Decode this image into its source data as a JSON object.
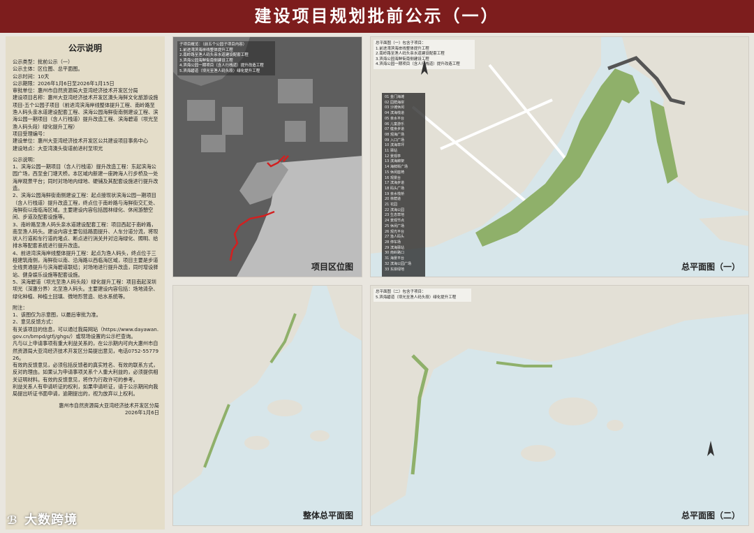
{
  "header": {
    "title": "建设项目规划批前公示（一）"
  },
  "sidebar": {
    "title": "公示说明",
    "lines": [
      "公示类型：批前公示（一）",
      "公示主体：区位图、总平面图。",
      "公示时间：10天",
      "公示期限：2026年1月6日至2026年1月15日",
      "审批单位：惠州市自然资源局大亚湾经济技术开发区分局",
      "建设项目名称：惠州大亚湾经济技术开发区澳头海鲜文化旅游设施项目-五个公园子项目（前进湾滨海岸线整体提升工程、南岭路至渔人码头亲水道建设配套工程、滨海公园海鲜街南侧建设工程、滨海公园一期项目（含人行栈道）提升改造工程、滨海碧道（坝光至渔人码头段）绿化提升工程）",
      "项目受理编号：",
      "建设单位：惠州大亚湾经济技术开发区公共建设项目事务中心",
      "建设地点：大亚湾澳头街道前进村至坝光",
      "",
      "公示说明：",
      "1、滨海公园一期项目（含人行栈道）提升改造工程：东起滨海公园广场，西至金门塘天桥。本区域内新建一座跨海人行步桥及一处海岸观景平台；同时对场地内绿地、硬铺及其配套设施进行提升改造。",
      "2、滨海公园海鲜街南侧建设工程：起点接现状滨海公园一期项目（含人行栈道）提升改造工程，终点位于南岭路与海鲜街交汇处、海鲜街以南临海区域。主要建设内容包括园林绿化、休闲游憩空间、步道及配套设施等。",
      "3、南岭路至渔人码头亲水道建设配套工程：项目西起于南岭路，南至渔人码头。建设内容主要包括路面提升、人车分道分流，将现状人行道和车行道的堵点、断点进行消关并对沿海绿化、照明、给排水等配套系统进行提升改造。",
      "4、前进湾滨海岸线整体提升工程：起点为渔人码头，终点位于三桠建筑南侧，海鲜街以南、沿海路以西临海区域，项目主要是步道全线贯通提升与滨海碧道联结；对场地进行提升改造，同时增设驿站、健身娱乐设施等配套设施。",
      "5、滨海碧道（坝光至渔人码头段）绿化提升工程：项目南起深圳坝光（深惠分界）北至渔人码头。主要建设内容包括：场地清杂、绿化种植、种植土回填、微地形营造、给水系统等。",
      "",
      "附注：",
      "1、该图仅为示意图，以最后审批为准。",
      "2、意见反馈方式：",
      "有关该项目的信息，可以通过我局网站（https://www.dayawan.gov.cn/bmpd/gtfj/ghgs/）或现场设置的公示栏查询。",
      "凡与以上申请事项有重大利益关系的，在公示期内可向大惠州市自然资源局大亚湾经济技术开发区分局提出意见，电话0752-5577926。",
      "有效的反馈意见，必须包括反馈者的真实姓名、有效的联系方式，反对的理由。如果认为申请事项关系个人重大利益的，必须提供相关证明材料。有效的反馈意见，将作为行政许可的参考。",
      "利益关系人有申请听证的权利，如果申请听证，请于公示期间向我局提出听证书面申请，逾期提出的，视为放弃以上权利。",
      ""
    ],
    "sign_org": "惠州市自然资源局大亚湾经济技术开发区分局",
    "sign_date": "2026年1月6日"
  },
  "panels": {
    "location": {
      "label": "项目区位图",
      "legend": [
        "子项目概览：（前五个公园子项目内容）",
        "1.前进湾滨海岸线整体提升工程",
        "2.南岭路至渔人码头亲水道建设配套工程",
        "3.滨海公园海鲜街南侧建设工程",
        "4.滨海公园一期项目（含人行栈道）提升改造工程",
        "5.滨海碧道（坝光至渔人码头段）绿化提升工程"
      ]
    },
    "plan1": {
      "label": "总平面图（一）",
      "legend": [
        "总平面图（一）包含子项目：",
        "1.前进湾滨海岸线整体提升工程",
        "2.南岭路至渔人码头亲水道建设配套工程",
        "3.滨海公园海鲜街南侧建设工程",
        "4.滨海公园一期项目（含人行栈道）提升改造工程"
      ],
      "poi": [
        "01 金门海滩",
        "02 园荫海岸",
        "03 沙滩休闲",
        "04 滨海栈道",
        "05 亲水平台",
        "06 儿童游乐",
        "07 健身步道",
        "08 观海广场",
        "09 入口广场",
        "10 滨海草坪",
        "11 驿站",
        "12 景观亭",
        "13 滨海廊架",
        "14 海鲜街广场",
        "15 休闲座椅",
        "16 观景台",
        "17 滨海步道",
        "18 码头广场",
        "19 亲水栈桥",
        "20 林荫道",
        "21 花园",
        "22 滨海公园",
        "23 生态草地",
        "24 景观节点",
        "25 休闲广场",
        "26 观光平台",
        "27 渔人码头",
        "28 停车场",
        "29 滨海驿站",
        "30 南岭路口",
        "31 海景平台",
        "32 滨海公园广场",
        "33 东岸绿地"
      ]
    },
    "overall": {
      "label": "整体总平面图"
    },
    "plan2": {
      "label": "总平面图（二）",
      "legend": [
        "总平面图（二）包含子项目：",
        "5.滨海碧道（坝光至渔人码头段）绿化提升工程"
      ]
    }
  },
  "watermark": {
    "mark": "ℬ",
    "text": "大数跨境"
  },
  "colors": {
    "banner": "#7d1d1d",
    "sidebar_bg": "#e4ddc9",
    "sea": "#d7e6ea",
    "land": "#e3e0d6",
    "green": "#8fb06a",
    "route_red": "#d22020"
  }
}
